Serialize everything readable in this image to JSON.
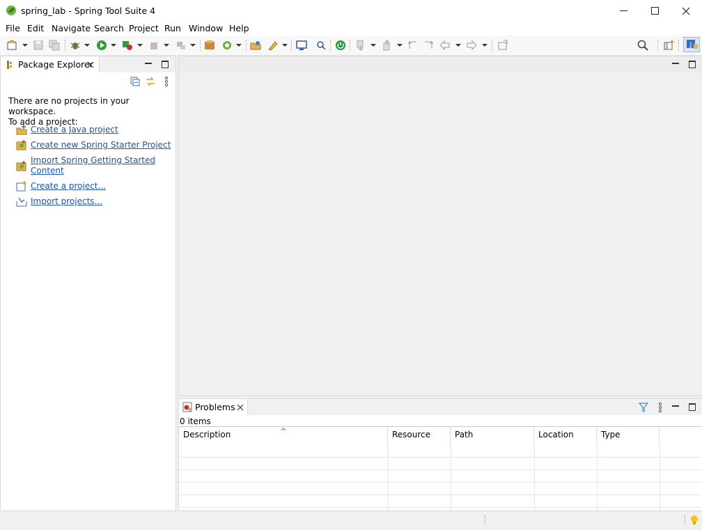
{
  "window": {
    "title": "spring_lab - Spring Tool Suite 4"
  },
  "menu": [
    "File",
    "Edit",
    "Navigate",
    "Search",
    "Project",
    "Run",
    "Window",
    "Help"
  ],
  "package_explorer": {
    "tab_label": "Package Explorer",
    "empty_message_line1": "There are no projects in your workspace.",
    "empty_message_line2": "To add a project:",
    "links": {
      "java": "Create a Java project",
      "spring_starter": "Create new Spring Starter Project",
      "getting_started_line1": "Import Spring Getting Started",
      "getting_started_line2": "Content",
      "create_project": "Create a project...",
      "import_projects": "Import projects..."
    }
  },
  "problems": {
    "tab_label": "Problems",
    "count": "0 items",
    "columns": [
      "Description",
      "Resource",
      "Path",
      "Location",
      "Type"
    ]
  },
  "colors": {
    "link": "#1a55b3",
    "spring_green": "#6db33f",
    "run_green": "#2e9e3a"
  }
}
